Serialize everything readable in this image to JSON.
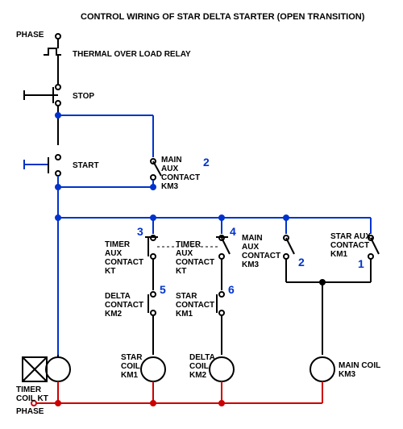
{
  "title": "CONTROL WIRING OF STAR DELTA STARTER (OPEN TRANSITION)",
  "phase_top": "PHASE",
  "phase_bottom": "PHASE",
  "thermal_relay": "THERMAL OVER LOAD RELAY",
  "stop": "STOP",
  "start": "START",
  "main_aux_km3_a": "MAIN\nAUX\nCONTACT\nKM3",
  "timer_aux_kt_a": "TIMER\nAUX\nCONTACT\nKT",
  "timer_aux_kt_b": "TIMER\nAUX\nCONTACT\nKT",
  "delta_contact_km2": "DELTA\nCONTACT\nKM2",
  "star_contact_km1": "STAR\nCONTACT\nKM1",
  "main_aux_km3_b": "MAIN\nAUX\nCONTACT\nKM3",
  "star_aux_km1": "STAR AUX.\nCONTACT\nKM1",
  "timer_coil": "TIMER\nCOIL KT",
  "star_coil": "STAR\nCOIL\nKM1",
  "delta_coil": "DELTA\nCOIL\nKM2",
  "main_coil": "MAIN COIL\nKM3",
  "n1": "1",
  "n2a": "2",
  "n2b": "2",
  "n3": "3",
  "n4": "4",
  "n5": "5",
  "n6": "6",
  "chart_data": {
    "type": "wiring-diagram",
    "title": "CONTROL WIRING OF STAR DELTA STARTER (OPEN TRANSITION)",
    "supply": {
      "top": "PHASE",
      "bottom": "PHASE"
    },
    "series_elements_top_to_bus": [
      {
        "name": "Thermal Overload Relay",
        "symbol": "NC"
      },
      {
        "name": "STOP",
        "symbol": "pushbutton-NC"
      },
      {
        "name": "START",
        "symbol": "pushbutton-NO",
        "parallel_with": "Main Aux Contact KM3 (seal-in)"
      }
    ],
    "branches": [
      {
        "name": "Timer branch",
        "contacts": [],
        "coil": "TIMER COIL KT"
      },
      {
        "name": "Star branch",
        "contacts": [
          {
            "label": "Timer Aux Contact KT",
            "type": "NC-timed",
            "ref": 3
          },
          {
            "label": "Delta Contact KM2",
            "type": "NC-interlock",
            "ref": 5
          }
        ],
        "coil": "STAR COIL KM1"
      },
      {
        "name": "Delta branch",
        "contacts": [
          {
            "label": "Timer Aux Contact KT",
            "type": "NO-timed",
            "ref": 4
          },
          {
            "label": "Star Contact KM1",
            "type": "NC-interlock",
            "ref": 6
          }
        ],
        "coil": "DELTA COIL KM2"
      },
      {
        "name": "Main branch",
        "parallel_paths": [
          {
            "contacts": [
              {
                "label": "Main Aux Contact KM3",
                "type": "NO",
                "ref": 2
              }
            ]
          },
          {
            "contacts": [
              {
                "label": "Star Aux Contact KM1",
                "type": "NO",
                "ref": 1
              }
            ]
          }
        ],
        "coil": "MAIN COIL KM3"
      }
    ],
    "reference_numbers": [
      1,
      2,
      3,
      4,
      5,
      6
    ]
  }
}
